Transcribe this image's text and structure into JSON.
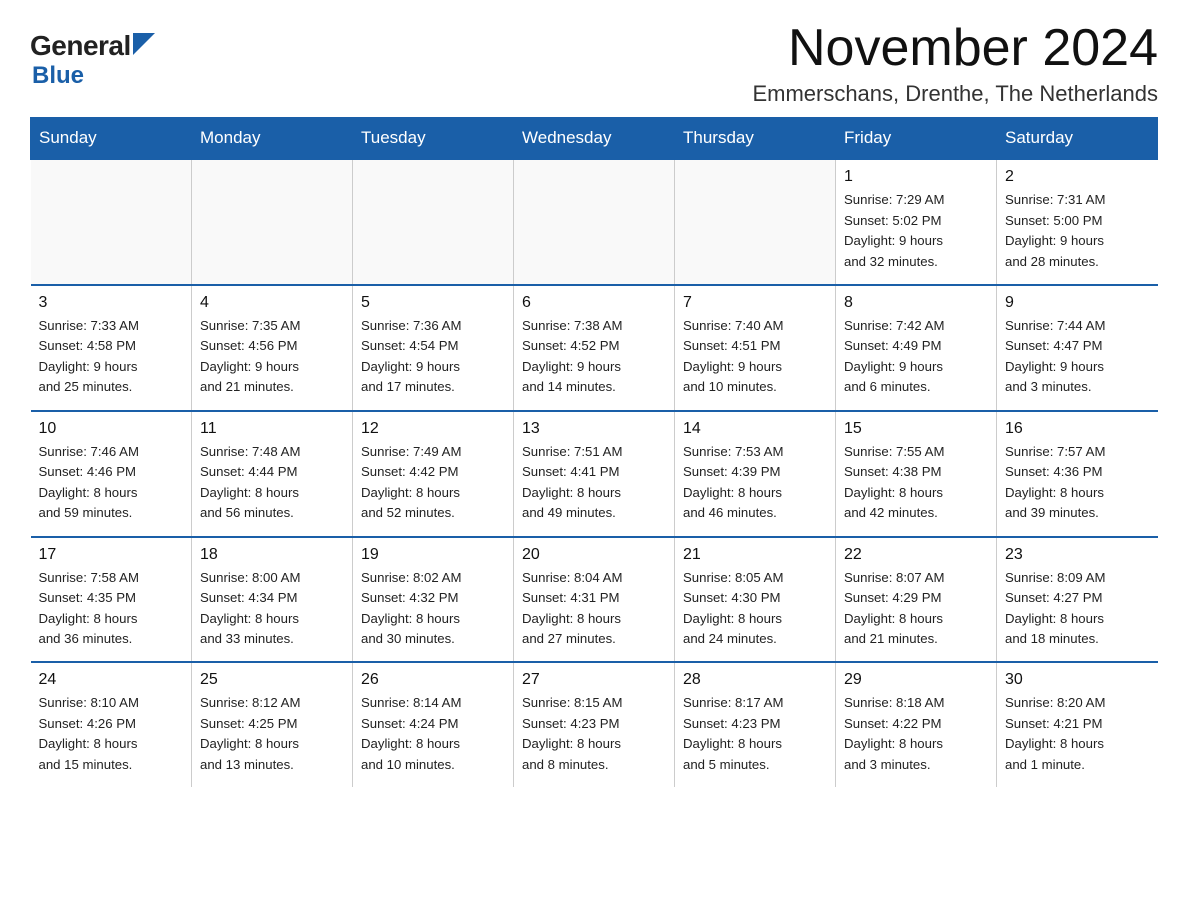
{
  "logo": {
    "general": "General",
    "blue": "Blue",
    "arrow_color": "#1a5fa8"
  },
  "title": "November 2024",
  "subtitle": "Emmerschans, Drenthe, The Netherlands",
  "header_bg": "#1a5fa8",
  "days": [
    "Sunday",
    "Monday",
    "Tuesday",
    "Wednesday",
    "Thursday",
    "Friday",
    "Saturday"
  ],
  "weeks": [
    [
      {
        "day": "",
        "info": ""
      },
      {
        "day": "",
        "info": ""
      },
      {
        "day": "",
        "info": ""
      },
      {
        "day": "",
        "info": ""
      },
      {
        "day": "",
        "info": ""
      },
      {
        "day": "1",
        "info": "Sunrise: 7:29 AM\nSunset: 5:02 PM\nDaylight: 9 hours\nand 32 minutes."
      },
      {
        "day": "2",
        "info": "Sunrise: 7:31 AM\nSunset: 5:00 PM\nDaylight: 9 hours\nand 28 minutes."
      }
    ],
    [
      {
        "day": "3",
        "info": "Sunrise: 7:33 AM\nSunset: 4:58 PM\nDaylight: 9 hours\nand 25 minutes."
      },
      {
        "day": "4",
        "info": "Sunrise: 7:35 AM\nSunset: 4:56 PM\nDaylight: 9 hours\nand 21 minutes."
      },
      {
        "day": "5",
        "info": "Sunrise: 7:36 AM\nSunset: 4:54 PM\nDaylight: 9 hours\nand 17 minutes."
      },
      {
        "day": "6",
        "info": "Sunrise: 7:38 AM\nSunset: 4:52 PM\nDaylight: 9 hours\nand 14 minutes."
      },
      {
        "day": "7",
        "info": "Sunrise: 7:40 AM\nSunset: 4:51 PM\nDaylight: 9 hours\nand 10 minutes."
      },
      {
        "day": "8",
        "info": "Sunrise: 7:42 AM\nSunset: 4:49 PM\nDaylight: 9 hours\nand 6 minutes."
      },
      {
        "day": "9",
        "info": "Sunrise: 7:44 AM\nSunset: 4:47 PM\nDaylight: 9 hours\nand 3 minutes."
      }
    ],
    [
      {
        "day": "10",
        "info": "Sunrise: 7:46 AM\nSunset: 4:46 PM\nDaylight: 8 hours\nand 59 minutes."
      },
      {
        "day": "11",
        "info": "Sunrise: 7:48 AM\nSunset: 4:44 PM\nDaylight: 8 hours\nand 56 minutes."
      },
      {
        "day": "12",
        "info": "Sunrise: 7:49 AM\nSunset: 4:42 PM\nDaylight: 8 hours\nand 52 minutes."
      },
      {
        "day": "13",
        "info": "Sunrise: 7:51 AM\nSunset: 4:41 PM\nDaylight: 8 hours\nand 49 minutes."
      },
      {
        "day": "14",
        "info": "Sunrise: 7:53 AM\nSunset: 4:39 PM\nDaylight: 8 hours\nand 46 minutes."
      },
      {
        "day": "15",
        "info": "Sunrise: 7:55 AM\nSunset: 4:38 PM\nDaylight: 8 hours\nand 42 minutes."
      },
      {
        "day": "16",
        "info": "Sunrise: 7:57 AM\nSunset: 4:36 PM\nDaylight: 8 hours\nand 39 minutes."
      }
    ],
    [
      {
        "day": "17",
        "info": "Sunrise: 7:58 AM\nSunset: 4:35 PM\nDaylight: 8 hours\nand 36 minutes."
      },
      {
        "day": "18",
        "info": "Sunrise: 8:00 AM\nSunset: 4:34 PM\nDaylight: 8 hours\nand 33 minutes."
      },
      {
        "day": "19",
        "info": "Sunrise: 8:02 AM\nSunset: 4:32 PM\nDaylight: 8 hours\nand 30 minutes."
      },
      {
        "day": "20",
        "info": "Sunrise: 8:04 AM\nSunset: 4:31 PM\nDaylight: 8 hours\nand 27 minutes."
      },
      {
        "day": "21",
        "info": "Sunrise: 8:05 AM\nSunset: 4:30 PM\nDaylight: 8 hours\nand 24 minutes."
      },
      {
        "day": "22",
        "info": "Sunrise: 8:07 AM\nSunset: 4:29 PM\nDaylight: 8 hours\nand 21 minutes."
      },
      {
        "day": "23",
        "info": "Sunrise: 8:09 AM\nSunset: 4:27 PM\nDaylight: 8 hours\nand 18 minutes."
      }
    ],
    [
      {
        "day": "24",
        "info": "Sunrise: 8:10 AM\nSunset: 4:26 PM\nDaylight: 8 hours\nand 15 minutes."
      },
      {
        "day": "25",
        "info": "Sunrise: 8:12 AM\nSunset: 4:25 PM\nDaylight: 8 hours\nand 13 minutes."
      },
      {
        "day": "26",
        "info": "Sunrise: 8:14 AM\nSunset: 4:24 PM\nDaylight: 8 hours\nand 10 minutes."
      },
      {
        "day": "27",
        "info": "Sunrise: 8:15 AM\nSunset: 4:23 PM\nDaylight: 8 hours\nand 8 minutes."
      },
      {
        "day": "28",
        "info": "Sunrise: 8:17 AM\nSunset: 4:23 PM\nDaylight: 8 hours\nand 5 minutes."
      },
      {
        "day": "29",
        "info": "Sunrise: 8:18 AM\nSunset: 4:22 PM\nDaylight: 8 hours\nand 3 minutes."
      },
      {
        "day": "30",
        "info": "Sunrise: 8:20 AM\nSunset: 4:21 PM\nDaylight: 8 hours\nand 1 minute."
      }
    ]
  ]
}
